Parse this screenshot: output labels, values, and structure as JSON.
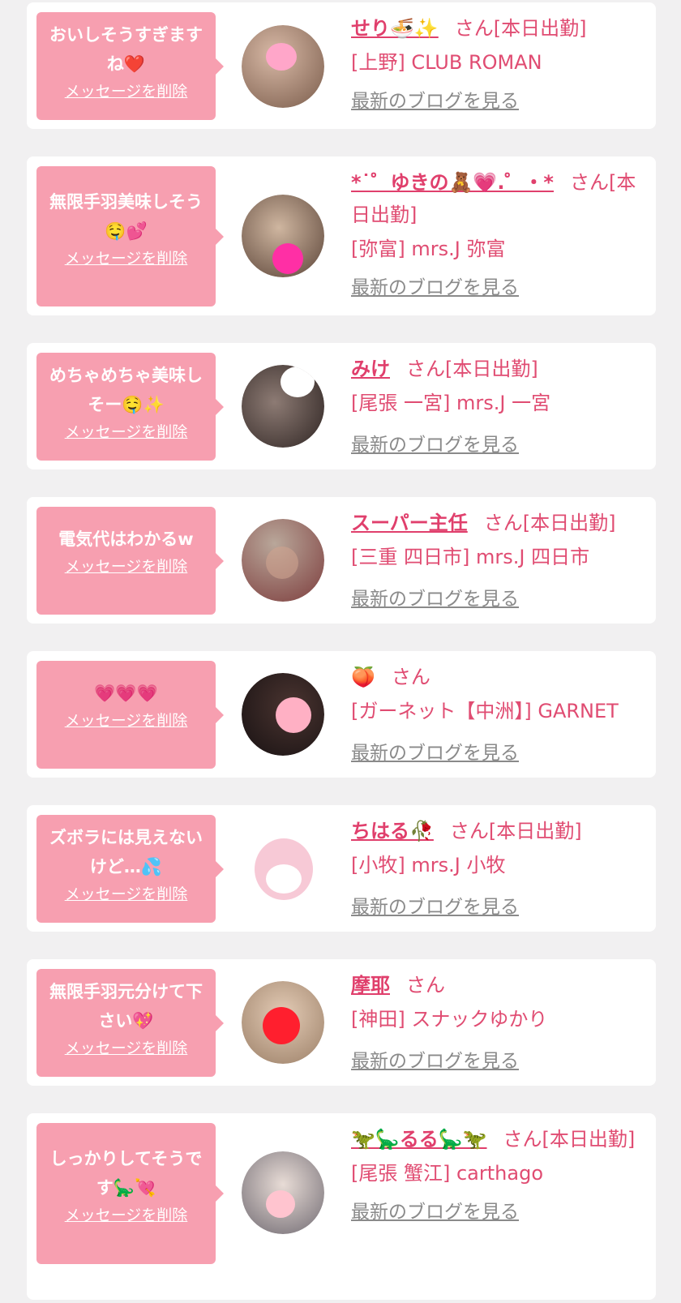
{
  "colors": {
    "page_bg": "#f1f0f1",
    "bubble_bg": "#f79fb0",
    "name_text": "#e03f6c",
    "shop_text": "#e04c72",
    "blog_link": "#8a8a8a"
  },
  "delete_label": "メッセージを削除",
  "blog_label": "最新のブログを見る",
  "cards": [
    {
      "message": "おいしそうすぎますね❤️",
      "name": "せり🍜✨",
      "suffix": "さん[本日出勤]",
      "shop": "[上野] CLUB ROMAN",
      "avatar": {
        "bg1": "#d8b9a6",
        "bg2": "#7a5c4b",
        "sticker": "#ffa6c9"
      }
    },
    {
      "message": "無限手羽美味しそう🤤💕",
      "name": "*˙゜ゆきの🧸💗.゜・*",
      "suffix": "さん[本日出勤]",
      "shop": "[弥富] mrs.J 弥富",
      "avatar": {
        "bg1": "#cfb6a0",
        "bg2": "#5b4438",
        "sticker": "#ff2fa5"
      }
    },
    {
      "message": "めちゃめちゃ美味しそー🤤✨",
      "name": "みけ",
      "suffix": "さん[本日出勤]",
      "shop": "[尾張 一宮] mrs.J 一宮",
      "avatar": {
        "bg1": "#8d7b74",
        "bg2": "#2f2523",
        "sticker": "#ffffff"
      }
    },
    {
      "message": "電気代はわかるw",
      "name": "スーパー主任",
      "suffix": "さん[本日出勤]",
      "shop": "[三重 四日市] mrs.J 四日市",
      "avatar": {
        "bg1": "#b9a79a",
        "bg2": "#7d3d3d",
        "sticker": "#cfa38f"
      }
    },
    {
      "message": "💗💗💗",
      "name": "🍑",
      "suffix": "さん",
      "shop": "[ガーネット【中洲】] GARNET",
      "avatar": {
        "bg1": "#4a3430",
        "bg2": "#171112",
        "sticker": "#ffb0c4"
      }
    },
    {
      "message": "ズボラには見えないけど…💦",
      "name": "ちはる🥀",
      "suffix": "さん[本日出勤]",
      "shop": "[小牧] mrs.J 小牧",
      "avatar": {
        "bg1": "#ffffff",
        "bg2": "#f4f0f0",
        "sticker": "#f7c9d6"
      }
    },
    {
      "message": "無限手羽元分けて下さい💖",
      "name": "摩耶",
      "suffix": "さん",
      "shop": "[神田] スナックゆかり",
      "avatar": {
        "bg1": "#e4ccb6",
        "bg2": "#9b7f67",
        "sticker": "#ff1f2e"
      }
    },
    {
      "message": "しっかりしてそうです🦕💘",
      "name": "🦖🦕るる🦕🦖",
      "suffix": "さん[本日出勤]",
      "shop": "[尾張 蟹江] carthago",
      "avatar": {
        "bg1": "#e8dcd6",
        "bg2": "#706a72",
        "sticker": "#ffc4cf"
      }
    }
  ]
}
